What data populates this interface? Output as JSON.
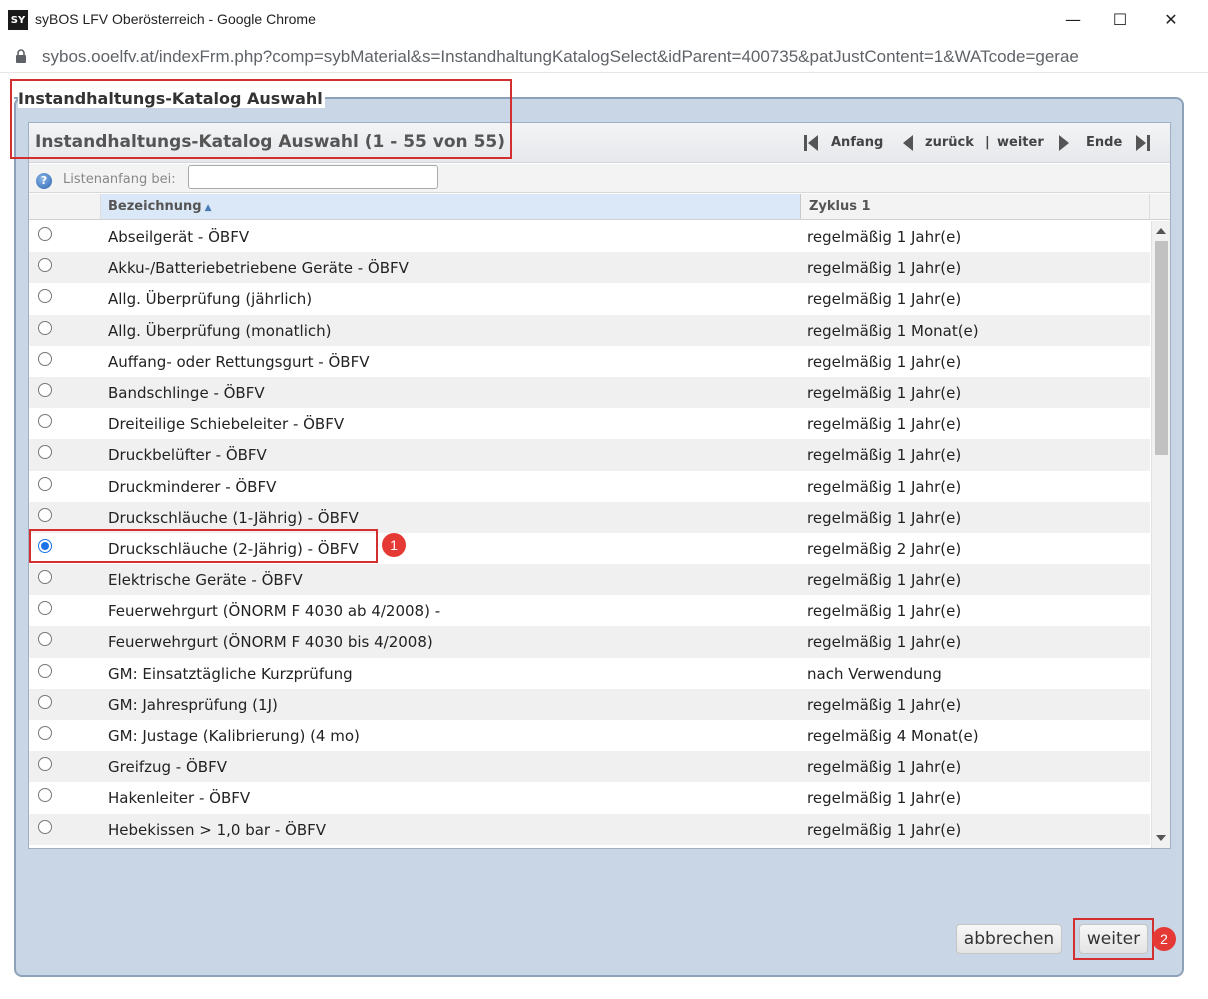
{
  "window": {
    "logo_text": "SY",
    "title": "syBOS LFV Oberösterreich - Google Chrome",
    "minimize": "—",
    "maximize": "☐",
    "close": "✕"
  },
  "address": {
    "url": "sybos.ooelfv.at/indexFrm.php?comp=sybMaterial&s=InstandhaltungKatalogSelect&idParent=400735&patJustContent=1&WATcode=gerae"
  },
  "fieldset": {
    "legend": "Instandhaltungs-Katalog Auswahl"
  },
  "panel": {
    "title": "Instandhaltungs-Katalog Auswahl (1 - 55 von 55)",
    "pager": {
      "first": "Anfang",
      "prev": "zurück",
      "separator": "|",
      "next": "weiter",
      "last": "Ende"
    },
    "filter": {
      "help": "?",
      "label": "Listenanfang bei:",
      "value": ""
    },
    "columns": {
      "name": "Bezeichnung",
      "cycle": "Zyklus 1"
    },
    "rows": [
      {
        "name": "Abseilgerät - ÖBFV",
        "cycle": "regelmäßig 1 Jahr(e)",
        "selected": false
      },
      {
        "name": "Akku-/Batteriebetriebene Geräte - ÖBFV",
        "cycle": "regelmäßig 1 Jahr(e)",
        "selected": false
      },
      {
        "name": "Allg. Überprüfung (jährlich)",
        "cycle": "regelmäßig 1 Jahr(e)",
        "selected": false
      },
      {
        "name": "Allg. Überprüfung (monatlich)",
        "cycle": "regelmäßig 1 Monat(e)",
        "selected": false
      },
      {
        "name": "Auffang- oder Rettungsgurt - ÖBFV",
        "cycle": "regelmäßig 1 Jahr(e)",
        "selected": false
      },
      {
        "name": "Bandschlinge - ÖBFV",
        "cycle": "regelmäßig 1 Jahr(e)",
        "selected": false
      },
      {
        "name": "Dreiteilige Schiebeleiter - ÖBFV",
        "cycle": "regelmäßig 1 Jahr(e)",
        "selected": false
      },
      {
        "name": "Druckbelüfter - ÖBFV",
        "cycle": "regelmäßig 1 Jahr(e)",
        "selected": false
      },
      {
        "name": "Druckminderer - ÖBFV",
        "cycle": "regelmäßig 1 Jahr(e)",
        "selected": false
      },
      {
        "name": "Druckschläuche (1-Jährig) - ÖBFV",
        "cycle": "regelmäßig 1 Jahr(e)",
        "selected": false
      },
      {
        "name": "Druckschläuche (2-Jährig) - ÖBFV",
        "cycle": "regelmäßig 2 Jahr(e)",
        "selected": true
      },
      {
        "name": "Elektrische Geräte - ÖBFV",
        "cycle": "regelmäßig 1 Jahr(e)",
        "selected": false
      },
      {
        "name": "Feuerwehrgurt (ÖNORM F 4030 ab 4/2008) -",
        "cycle": "regelmäßig 1 Jahr(e)",
        "selected": false
      },
      {
        "name": "Feuerwehrgurt (ÖNORM F 4030 bis 4/2008)",
        "cycle": "regelmäßig 1 Jahr(e)",
        "selected": false
      },
      {
        "name": "GM: Einsatztägliche Kurzprüfung",
        "cycle": "nach Verwendung",
        "selected": false
      },
      {
        "name": "GM: Jahresprüfung (1J)",
        "cycle": "regelmäßig 1 Jahr(e)",
        "selected": false
      },
      {
        "name": "GM: Justage (Kalibrierung) (4 mo)",
        "cycle": "regelmäßig 4 Monat(e)",
        "selected": false
      },
      {
        "name": "Greifzug - ÖBFV",
        "cycle": "regelmäßig 1 Jahr(e)",
        "selected": false
      },
      {
        "name": "Hakenleiter - ÖBFV",
        "cycle": "regelmäßig 1 Jahr(e)",
        "selected": false
      },
      {
        "name": "Hebekissen > 1,0 bar - ÖBFV",
        "cycle": "regelmäßig 1 Jahr(e)",
        "selected": false
      }
    ]
  },
  "buttons": {
    "cancel": "abbrechen",
    "next": "weiter"
  },
  "annotations": {
    "badge1": "1",
    "badge2": "2",
    "color": "#d32f2f"
  }
}
